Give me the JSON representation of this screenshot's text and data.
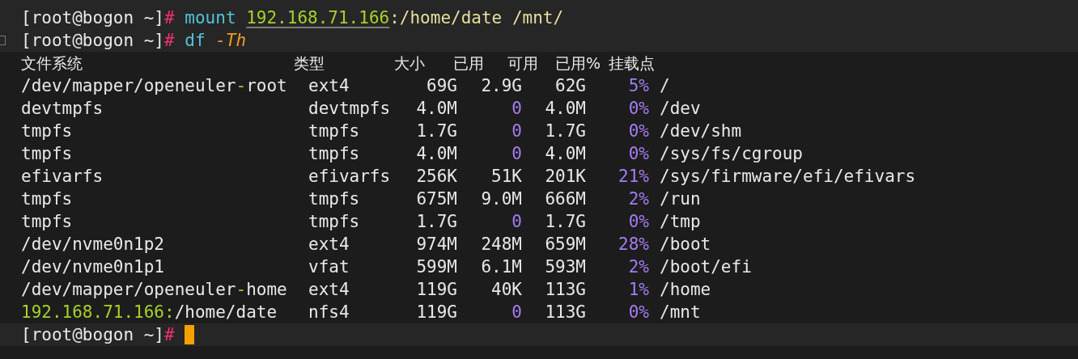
{
  "lines": [
    {
      "kind": "command",
      "cursor": false,
      "segments": [
        {
          "text": "[root@bogon ~]",
          "kind": "plain"
        },
        {
          "text": "# ",
          "kind": "hash"
        },
        {
          "text": "mount ",
          "kind": "command"
        },
        {
          "text": "192.168.71.166",
          "kind": "ip_link"
        },
        {
          "text": ":/home/date /mnt/",
          "kind": "path"
        }
      ]
    },
    {
      "kind": "command",
      "cursor": false,
      "segments": [
        {
          "text": "[root@bogon ~]",
          "kind": "plain"
        },
        {
          "text": "# ",
          "kind": "hash"
        },
        {
          "text": "df ",
          "kind": "command"
        },
        {
          "text": "-Th",
          "kind": "flag"
        }
      ]
    },
    {
      "kind": "header",
      "columns": [
        "文件系统",
        "类型",
        "大小",
        "已用",
        "可用",
        "已用%",
        "挂载点"
      ]
    },
    {
      "kind": "row",
      "filesystem": [
        {
          "text": "/dev/mapper/openeuler",
          "kind": "plain"
        },
        {
          "text": "-",
          "kind": "accent"
        },
        {
          "text": "root",
          "kind": "plain"
        }
      ],
      "type": "ext4",
      "size": "69G",
      "used": {
        "text": "2.9G",
        "highlighted": false
      },
      "avail": "62G",
      "use_percent": "5%",
      "mounted_on": "/"
    },
    {
      "kind": "row",
      "filesystem": [
        {
          "text": "devtmpfs",
          "kind": "plain"
        }
      ],
      "type": "devtmpfs",
      "size": "4.0M",
      "used": {
        "text": "0",
        "highlighted": true
      },
      "avail": "4.0M",
      "use_percent": "0%",
      "mounted_on": "/dev"
    },
    {
      "kind": "row",
      "filesystem": [
        {
          "text": "tmpfs",
          "kind": "plain"
        }
      ],
      "type": "tmpfs",
      "size": "1.7G",
      "used": {
        "text": "0",
        "highlighted": true
      },
      "avail": "1.7G",
      "use_percent": "0%",
      "mounted_on": "/dev/shm"
    },
    {
      "kind": "row",
      "filesystem": [
        {
          "text": "tmpfs",
          "kind": "plain"
        }
      ],
      "type": "tmpfs",
      "size": "4.0M",
      "used": {
        "text": "0",
        "highlighted": true
      },
      "avail": "4.0M",
      "use_percent": "0%",
      "mounted_on": "/sys/fs/cgroup"
    },
    {
      "kind": "row",
      "filesystem": [
        {
          "text": "efivarfs",
          "kind": "plain"
        }
      ],
      "type": "efivarfs",
      "size": "256K",
      "used": {
        "text": "51K",
        "highlighted": false
      },
      "avail": "201K",
      "use_percent": "21%",
      "mounted_on": "/sys/firmware/efi/efivars"
    },
    {
      "kind": "row",
      "filesystem": [
        {
          "text": "tmpfs",
          "kind": "plain"
        }
      ],
      "type": "tmpfs",
      "size": "675M",
      "used": {
        "text": "9.0M",
        "highlighted": false
      },
      "avail": "666M",
      "use_percent": "2%",
      "mounted_on": "/run"
    },
    {
      "kind": "row",
      "filesystem": [
        {
          "text": "tmpfs",
          "kind": "plain"
        }
      ],
      "type": "tmpfs",
      "size": "1.7G",
      "used": {
        "text": "0",
        "highlighted": true
      },
      "avail": "1.7G",
      "use_percent": "0%",
      "mounted_on": "/tmp"
    },
    {
      "kind": "row",
      "filesystem": [
        {
          "text": "/dev/nvme0n1p2",
          "kind": "plain"
        }
      ],
      "type": "ext4",
      "size": "974M",
      "used": {
        "text": "248M",
        "highlighted": false
      },
      "avail": "659M",
      "use_percent": "28%",
      "mounted_on": "/boot"
    },
    {
      "kind": "row",
      "filesystem": [
        {
          "text": "/dev/nvme0n1p1",
          "kind": "plain"
        }
      ],
      "type": "vfat",
      "size": "599M",
      "used": {
        "text": "6.1M",
        "highlighted": false
      },
      "avail": "593M",
      "use_percent": "2%",
      "mounted_on": "/boot/efi"
    },
    {
      "kind": "row",
      "filesystem": [
        {
          "text": "/dev/mapper/openeuler",
          "kind": "plain"
        },
        {
          "text": "-",
          "kind": "accent"
        },
        {
          "text": "home",
          "kind": "plain"
        }
      ],
      "type": "ext4",
      "size": "119G",
      "used": {
        "text": "40K",
        "highlighted": false
      },
      "avail": "113G",
      "use_percent": "1%",
      "mounted_on": "/home"
    },
    {
      "kind": "row",
      "filesystem": [
        {
          "text": "192.168.71.166:",
          "kind": "accent"
        },
        {
          "text": "/home/date",
          "kind": "plain"
        }
      ],
      "type": "nfs4",
      "size": "119G",
      "used": {
        "text": "0",
        "highlighted": true
      },
      "avail": "113G",
      "use_percent": "0%",
      "mounted_on": "/mnt"
    },
    {
      "kind": "command",
      "cursor": true,
      "segments": [
        {
          "text": "[root@bogon ~]",
          "kind": "plain"
        },
        {
          "text": "# ",
          "kind": "hash"
        }
      ]
    }
  ]
}
